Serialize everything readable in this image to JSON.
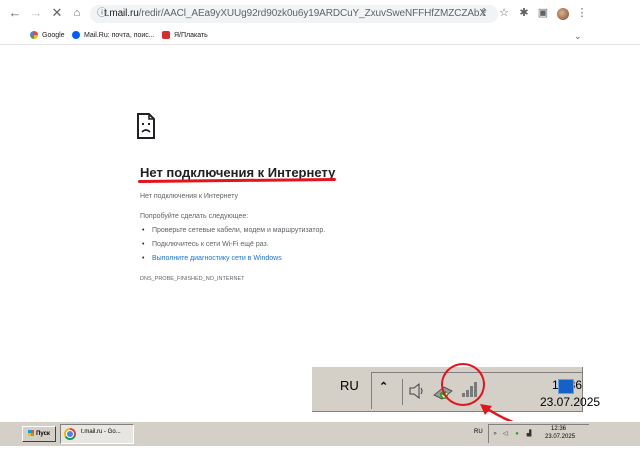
{
  "browser": {
    "url_host": "t.mail.ru",
    "url_rest": "/redir/AACl_AEa9yXUUg92rd90zk0u6y19ARDCuY_ZxuvSweNFFHfZMZCZAbXm6cDNxsRHR7rfDEdU...",
    "bookmarks": [
      {
        "label": "Google",
        "color": "#4285f4"
      },
      {
        "label": "Mail.Ru: почта, поис...",
        "color": "#005ff9"
      },
      {
        "label": "Я/Плакать",
        "color": "#d92d2d"
      }
    ]
  },
  "error_page": {
    "title": "Нет подключения к Интернету",
    "subtitle": "Нет подключения к Интернету",
    "try_heading": "Попробуйте сделать следующее:",
    "suggestions": [
      "Проверьте сетевые кабели, модем и маршрутизатор.",
      "Подключитесь к сети Wi-Fi ещё раз."
    ],
    "diagnostics_link": "Выполните диагностику сети в Windows",
    "error_code": "DNS_PROBE_FINISHED_NO_INTERNET"
  },
  "tray_zoom": {
    "language": "RU",
    "time": "12:36",
    "date": "23.07.2025"
  },
  "taskbar": {
    "start_label": "Пуск",
    "task_label": "t.mail.ru - Go...",
    "language": "RU",
    "time": "12:36",
    "date": "23.07.2025"
  },
  "colors": {
    "annotation_red": "#e3141c",
    "link_blue": "#1a73e8"
  }
}
